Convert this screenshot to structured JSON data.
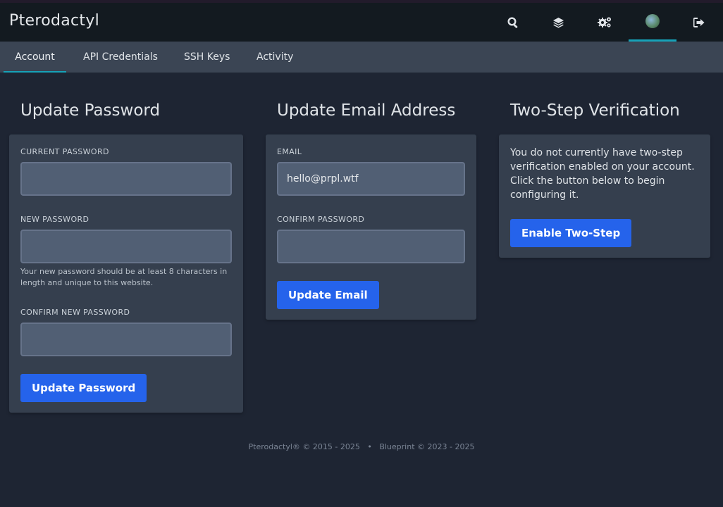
{
  "app": {
    "title": "Pterodactyl"
  },
  "topbar": {
    "icons": [
      "search-icon",
      "layers-icon",
      "cogs-icon",
      "avatar",
      "sign-out-icon"
    ]
  },
  "tabs": [
    {
      "label": "Account",
      "active": true
    },
    {
      "label": "API Credentials"
    },
    {
      "label": "SSH Keys"
    },
    {
      "label": "Activity"
    }
  ],
  "password": {
    "title": "Update Password",
    "current_label": "CURRENT PASSWORD",
    "new_label": "NEW PASSWORD",
    "new_help": "Your new password should be at least 8 characters in length and unique to this website.",
    "confirm_label": "CONFIRM NEW PASSWORD",
    "button": "Update Password"
  },
  "email": {
    "title": "Update Email Address",
    "email_label": "EMAIL",
    "email_value": "hello@prpl.wtf",
    "confirm_label": "CONFIRM PASSWORD",
    "button": "Update Email"
  },
  "twofa": {
    "title": "Two-Step Verification",
    "text": "You do not currently have two-step verification enabled on your account. Click the button below to begin configuring it.",
    "button": "Enable Two-Step"
  },
  "footer": {
    "text": "Pterodactyl® © 2015 - 2025   •   Blueprint © 2023 - 2025"
  },
  "colors": {
    "accent": "#2563eb",
    "tab_underline": "#17a2b8"
  }
}
